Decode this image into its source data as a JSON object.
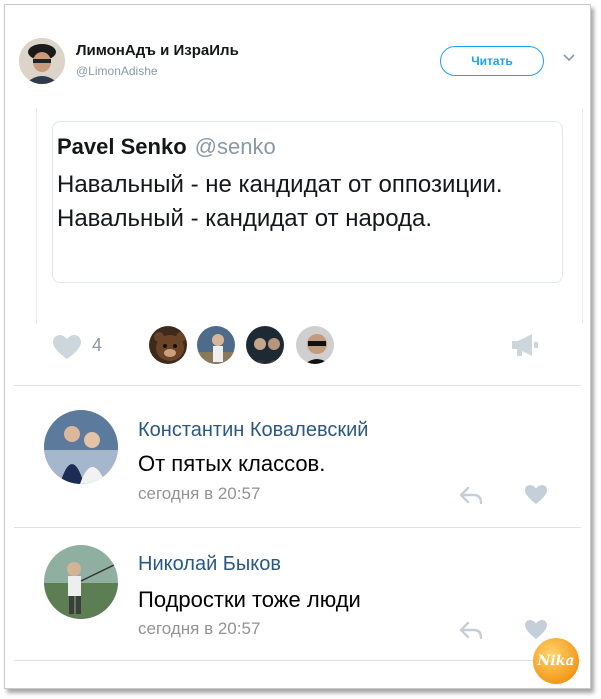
{
  "tweet": {
    "author_name": "ЛимонАдъ и ИзраИль",
    "author_handle": "@LimonAdishe",
    "follow_label": "Читать",
    "quoted": {
      "name": "Pavel Senko",
      "handle": "@senko",
      "text": "Навальный - не кандидат от оппозиции. Навальный - кандидат от народа."
    },
    "like_count": "4"
  },
  "comments": [
    {
      "author": "Константин Ковалевский",
      "text": "От пятых классов.",
      "time": "сегодня в 20:57"
    },
    {
      "author": "Николай Быков",
      "text": "Подростки тоже люди",
      "time": "сегодня в 20:57"
    }
  ],
  "watermark": "Nika",
  "colors": {
    "twitter_blue": "#1da1f2",
    "vk_name": "#2a5885",
    "muted": "#939393"
  }
}
